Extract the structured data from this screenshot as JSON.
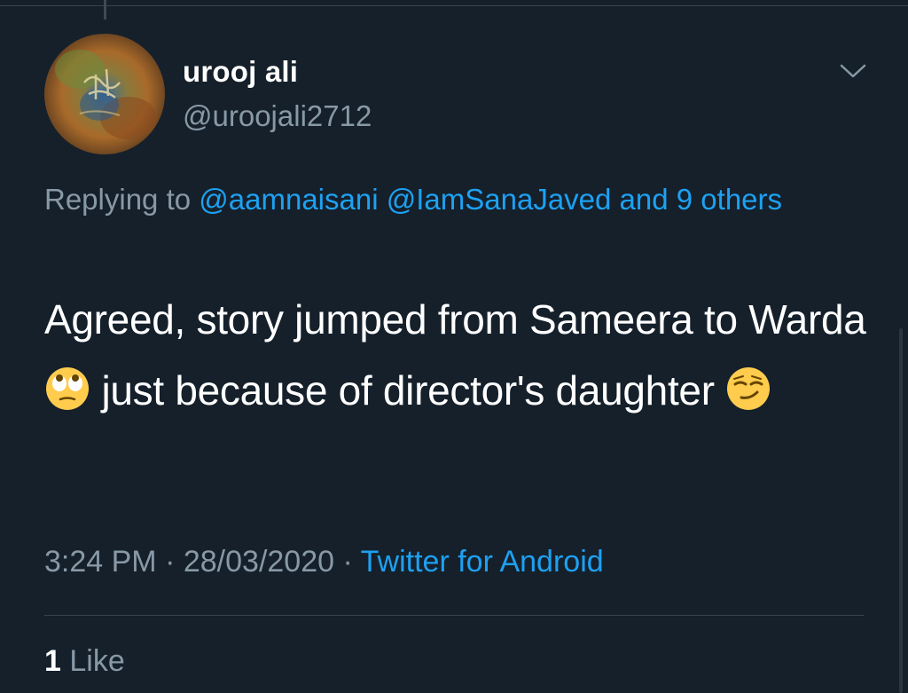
{
  "tweet": {
    "display_name": "urooj ali",
    "handle": "@uroojali2712",
    "replying_prefix": "Replying to",
    "replying_users": [
      "@aamnaisani",
      "@IamSanaJaved"
    ],
    "replying_others": "and 9 others",
    "text_part1": "Agreed, story jumped from Sameera to Warda",
    "text_part2": " just because of director's daughter ",
    "emoji_1": "face-with-rolling-eyes",
    "emoji_2": "smirking-face",
    "time": "3:24 PM",
    "separator": "·",
    "date": "28/03/2020",
    "source": "Twitter for Android",
    "like_count": "1",
    "like_label": "Like"
  },
  "colors": {
    "background": "#15202b",
    "primary_text": "#ffffff",
    "secondary_text": "#8899a6",
    "link": "#1da1f2",
    "divider": "#38444d"
  }
}
